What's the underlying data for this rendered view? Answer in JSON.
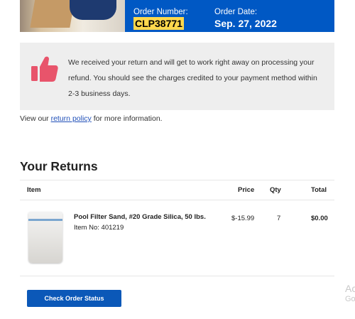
{
  "order": {
    "number_label": "Order Number:",
    "number": "CLP38771",
    "date_label": "Order Date:",
    "date": "Sep. 27, 2022"
  },
  "confirmation": {
    "message": "We received your return and will get to work right away on processing your refund. You should see the charges credited to your payment method within 2-3 business days.",
    "icon": "thumbs-up-icon",
    "icon_color": "#e8546b"
  },
  "policy": {
    "prefix": "View our ",
    "link_text": "return policy",
    "suffix": " for more information."
  },
  "returns": {
    "title": "Your Returns",
    "columns": {
      "item": "Item",
      "price": "Price",
      "qty": "Qty",
      "total": "Total"
    },
    "items": [
      {
        "name": "Pool Filter Sand, #20 Grade Silica, 50 lbs.",
        "item_no": "Item No: 401219",
        "price": "$-15.99",
        "qty": "7",
        "total": "$0.00"
      }
    ]
  },
  "actions": {
    "check_status_label": "Check Order Status"
  },
  "colors": {
    "brand_blue": "#0058c4",
    "button_blue": "#0b58b8",
    "highlight": "#ffd84d"
  }
}
